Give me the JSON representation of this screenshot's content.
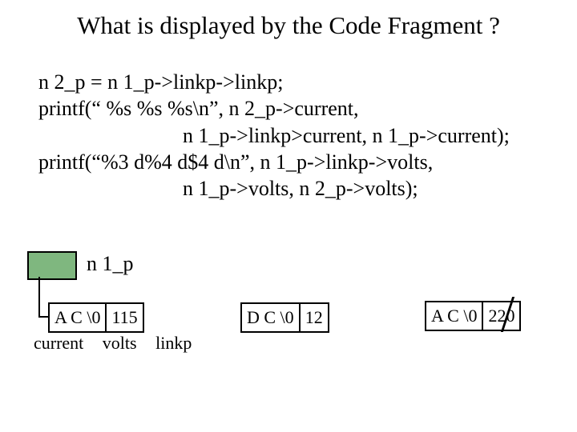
{
  "title": "What is displayed by the Code Fragment ?",
  "code": {
    "l1": "n 2_p = n 1_p->linkp->linkp;",
    "l2": "printf(“ %s %s %s\\n”, n 2_p->current,",
    "l3": "n 1_p->linkp>current, n 1_p->current);",
    "l4": "printf(“%3 d%4 d$4 d\\n”, n 1_p->linkp->volts,",
    "l5": "n 1_p->volts, n 2_p->volts);"
  },
  "pointer_label": "n 1_p",
  "nodes": {
    "n1": {
      "current": "A C \\0",
      "volts": "115"
    },
    "n2": {
      "current": "D C \\0",
      "volts": "12"
    },
    "n3": {
      "current": "A C \\0",
      "volts": "220"
    }
  },
  "field_labels": {
    "current": "current",
    "volts": "volts",
    "linkp": "linkp"
  },
  "colors": {
    "box": "#7fb77f"
  }
}
